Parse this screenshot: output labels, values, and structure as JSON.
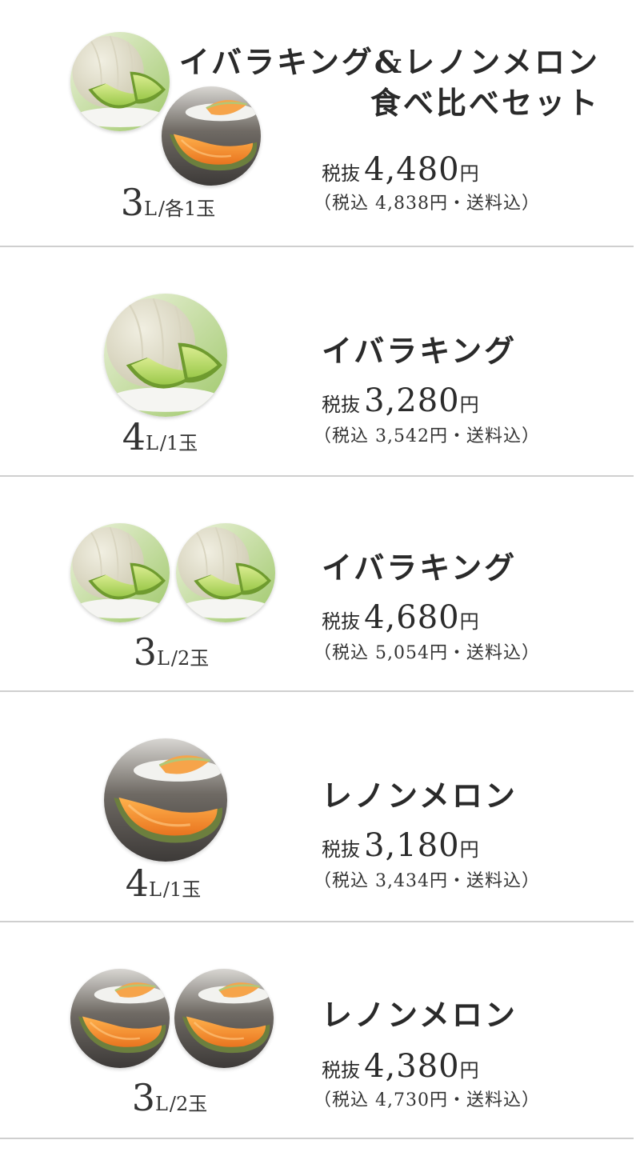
{
  "products": [
    {
      "title_line1": "イバラキング&レノンメロン",
      "title_line2": "食べ比べセット",
      "size_number": "3",
      "size_unit": "L",
      "size_rest": "/各1玉",
      "price_label": "税抜",
      "price": "4,480",
      "price_unit": "円",
      "tax_incl": "（税込 4,838円・送料込）"
    },
    {
      "title_line1": "イバラキング",
      "size_number": "4",
      "size_unit": "L",
      "size_rest": "/1玉",
      "price_label": "税抜",
      "price": "3,280",
      "price_unit": "円",
      "tax_incl": "（税込 3,542円・送料込）"
    },
    {
      "title_line1": "イバラキング",
      "size_number": "3",
      "size_unit": "L",
      "size_rest": "/2玉",
      "price_label": "税抜",
      "price": "4,680",
      "price_unit": "円",
      "tax_incl": "（税込 5,054円・送料込）"
    },
    {
      "title_line1": "レノンメロン",
      "size_number": "4",
      "size_unit": "L",
      "size_rest": "/1玉",
      "price_label": "税抜",
      "price": "3,180",
      "price_unit": "円",
      "tax_incl": "（税込 3,434円・送料込）"
    },
    {
      "title_line1": "レノンメロン",
      "size_number": "3",
      "size_unit": "L",
      "size_rest": "/2玉",
      "price_label": "税抜",
      "price": "4,380",
      "price_unit": "円",
      "tax_incl": "（税込 4,730円・送料込）"
    }
  ],
  "colors": {
    "green_flesh": "#b7d86a",
    "orange_flesh": "#f28a2e",
    "rind_green": "#7aa33a",
    "divider": "#cfcfcf"
  },
  "icons": {
    "green_melon": "green-melon-photo",
    "orange_melon": "orange-melon-photo"
  }
}
